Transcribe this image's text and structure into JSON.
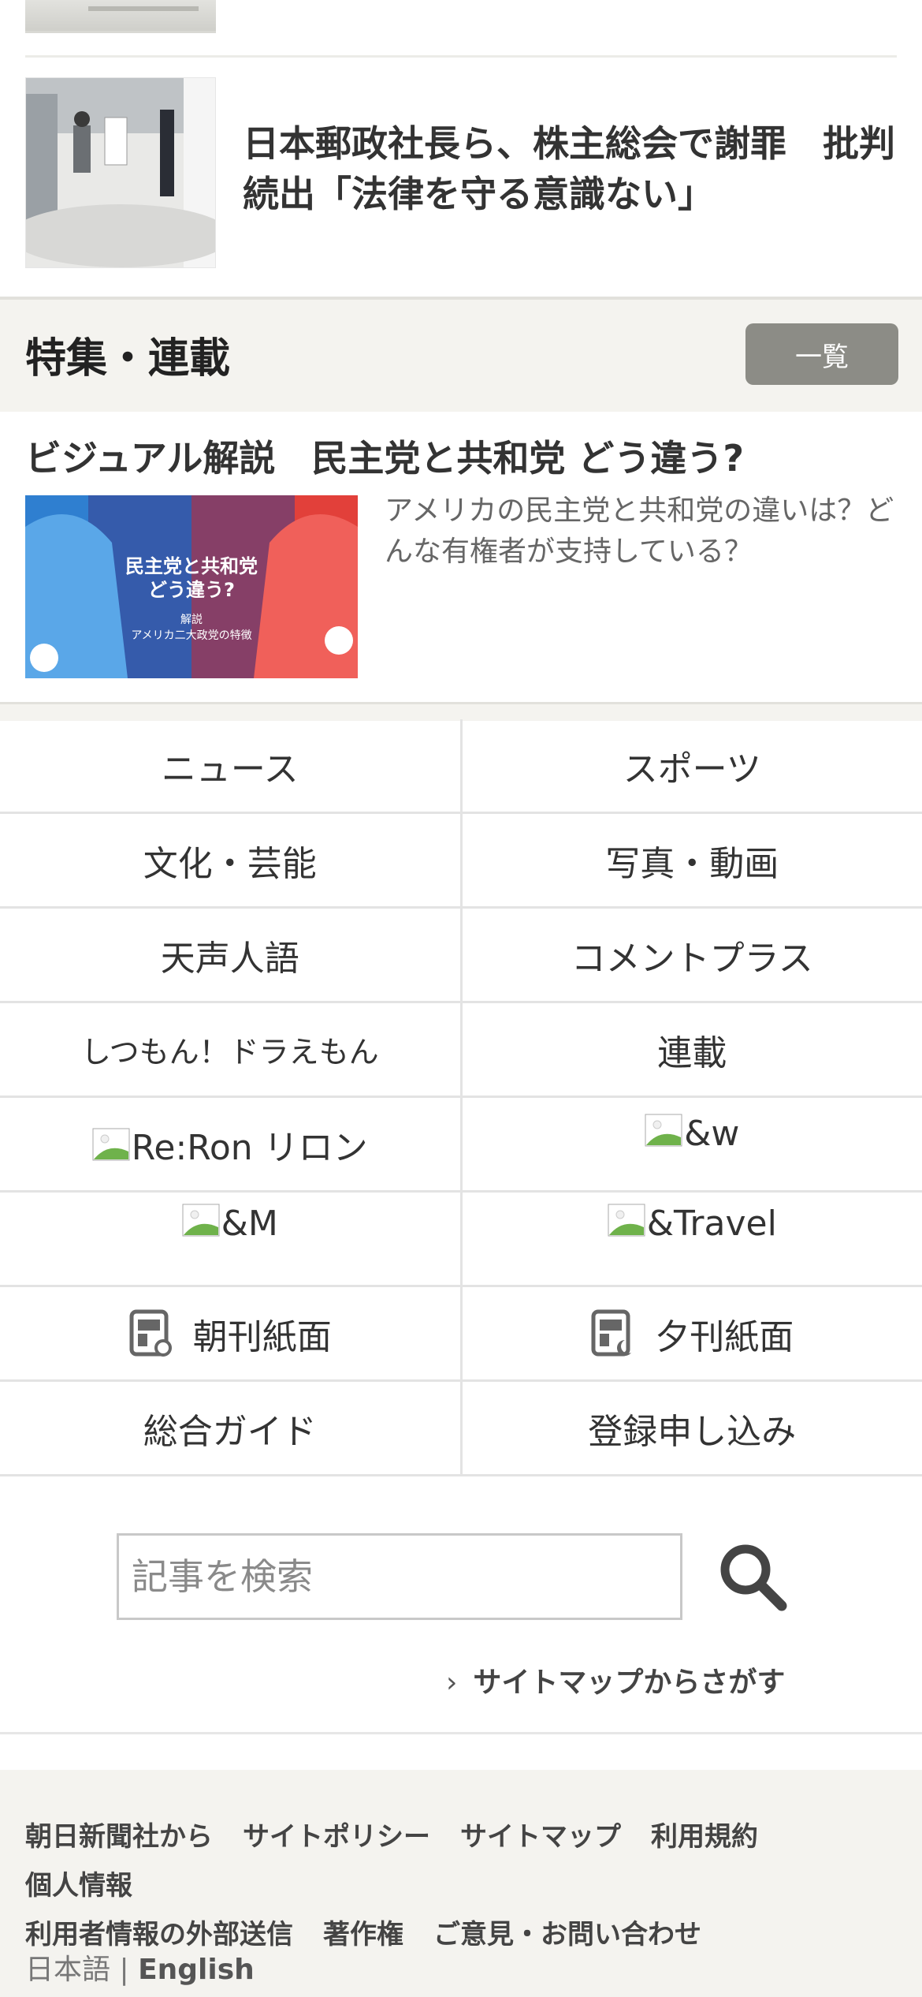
{
  "article": {
    "title": "日本郵政社長ら、株主総会で謝罪　批判続出「法律を守る意識ない」"
  },
  "features": {
    "heading": "特集・連載",
    "list_button": "一覧",
    "item": {
      "title": "ビジュアル解説　民主党と共和党 どう違う?",
      "description": "アメリカの民主党と共和党の違いは？どんな有権者が支持している？",
      "image_text_1": "民主党と共和党",
      "image_text_2": "どう違う?",
      "image_text_3": "解説",
      "image_text_4": "アメリカ二大政党の特徴"
    }
  },
  "nav": {
    "rows": [
      [
        "ニュース",
        "スポーツ"
      ],
      [
        "文化・芸能",
        "写真・動画"
      ],
      [
        "天声人語",
        "コメントプラス"
      ],
      [
        "しつもん！ドラえもん",
        "連載"
      ],
      [
        "Re:Ron リロン",
        "&w"
      ],
      [
        "&M",
        "&Travel"
      ],
      [
        "朝刊紙面",
        "夕刊紙面"
      ],
      [
        "総合ガイド",
        "登録申し込み"
      ]
    ]
  },
  "search": {
    "placeholder": "記事を検索",
    "sitemap_link": "サイトマップからさがす"
  },
  "footer": {
    "links": [
      "朝日新聞社から",
      "サイトポリシー",
      "サイトマップ",
      "利用規約",
      "個人情報",
      "利用者情報の外部送信",
      "著作権",
      "ご意見・お問い合わせ"
    ],
    "lang_ja": "日本語",
    "lang_sep": "|",
    "lang_en": "English"
  },
  "colors": {
    "accent_gray": "#8c8c86",
    "section_bg": "#f4f3ef",
    "democrat_blue": "#2f7fd0",
    "republican_red": "#e2403a"
  }
}
